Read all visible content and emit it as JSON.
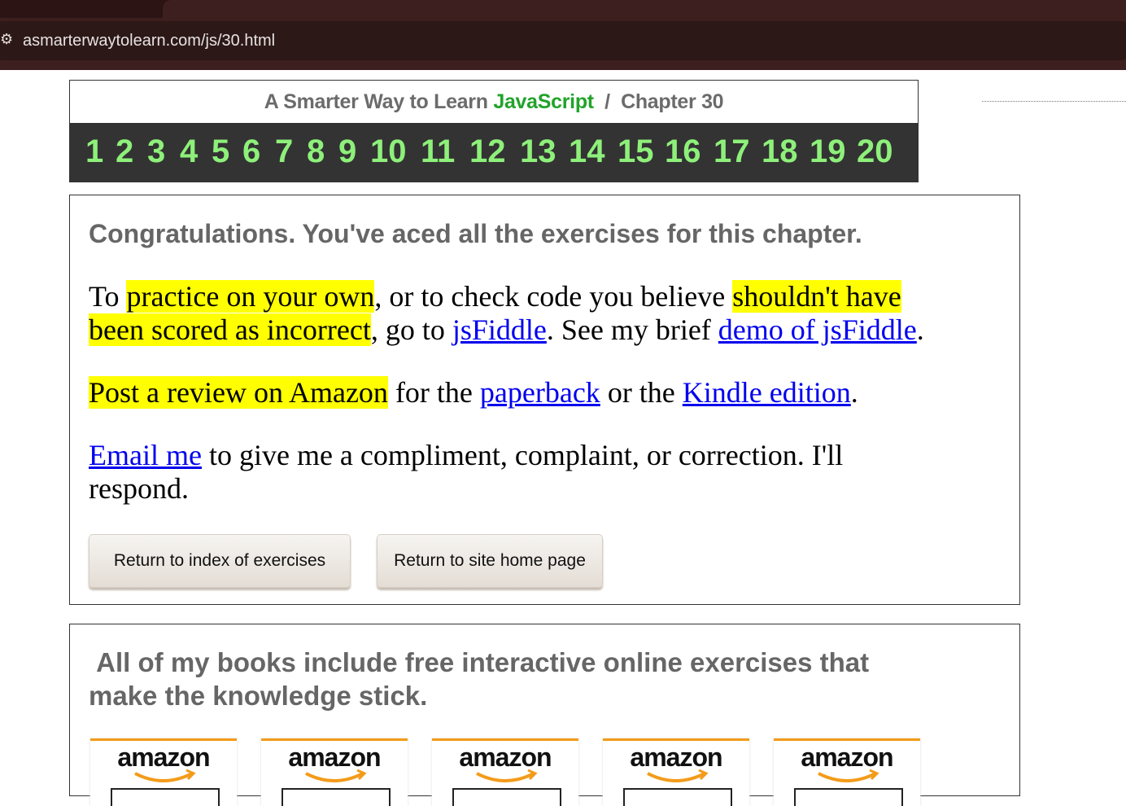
{
  "browser": {
    "url": "asmarterwaytolearn.com/js/30.html",
    "site_icon": "site-info-icon"
  },
  "chapter_header": {
    "title_prefix": "A Smarter Way to Learn",
    "title_brand": "JavaScript",
    "title_sep": "/",
    "title_chapter": "Chapter 30",
    "chapter_numbers": [
      "1",
      "2",
      "3",
      "4",
      "5",
      "6",
      "7",
      "8",
      "9",
      "10",
      "11",
      "12",
      "13",
      "14",
      "15",
      "16",
      "17",
      "18",
      "19",
      "20"
    ],
    "colors": {
      "brand": "#22a32a",
      "numbers": "#8ef07a",
      "bar": "#333333"
    }
  },
  "congrats": {
    "heading": "Congratulations. You've aced all the exercises for this chapter.",
    "p1": {
      "t1": "To ",
      "h1": "practice on your own",
      "t2": ", or to check code you believe ",
      "h2": "shouldn't have",
      "h3": "been scored as incorrect",
      "t3": ", go to ",
      "link1": "jsFiddle",
      "t4": ". See my brief ",
      "link2": "demo of jsFiddle",
      "t5": "."
    },
    "p2": {
      "h1": "Post a review on Amazon",
      "t1": " for the ",
      "link1": "paperback",
      "t2": " or the ",
      "link2": "Kindle edition",
      "t3": "."
    },
    "p3": {
      "link1": "Email me",
      "t1": " to give me a compliment, complaint, or correction. I'll",
      "t2": "respond."
    },
    "buttons": {
      "index": "Return to index of exercises",
      "home": "Return to site home page"
    },
    "colors": {
      "highlight": "#ffff00",
      "link": "#0000ee"
    }
  },
  "books": {
    "heading_line1": "All of my books include free interactive online exercises that",
    "heading_line2": "make the knowledge stick.",
    "amazon_logos": [
      "amazon",
      "amazon",
      "amazon",
      "amazon",
      "amazon"
    ]
  }
}
